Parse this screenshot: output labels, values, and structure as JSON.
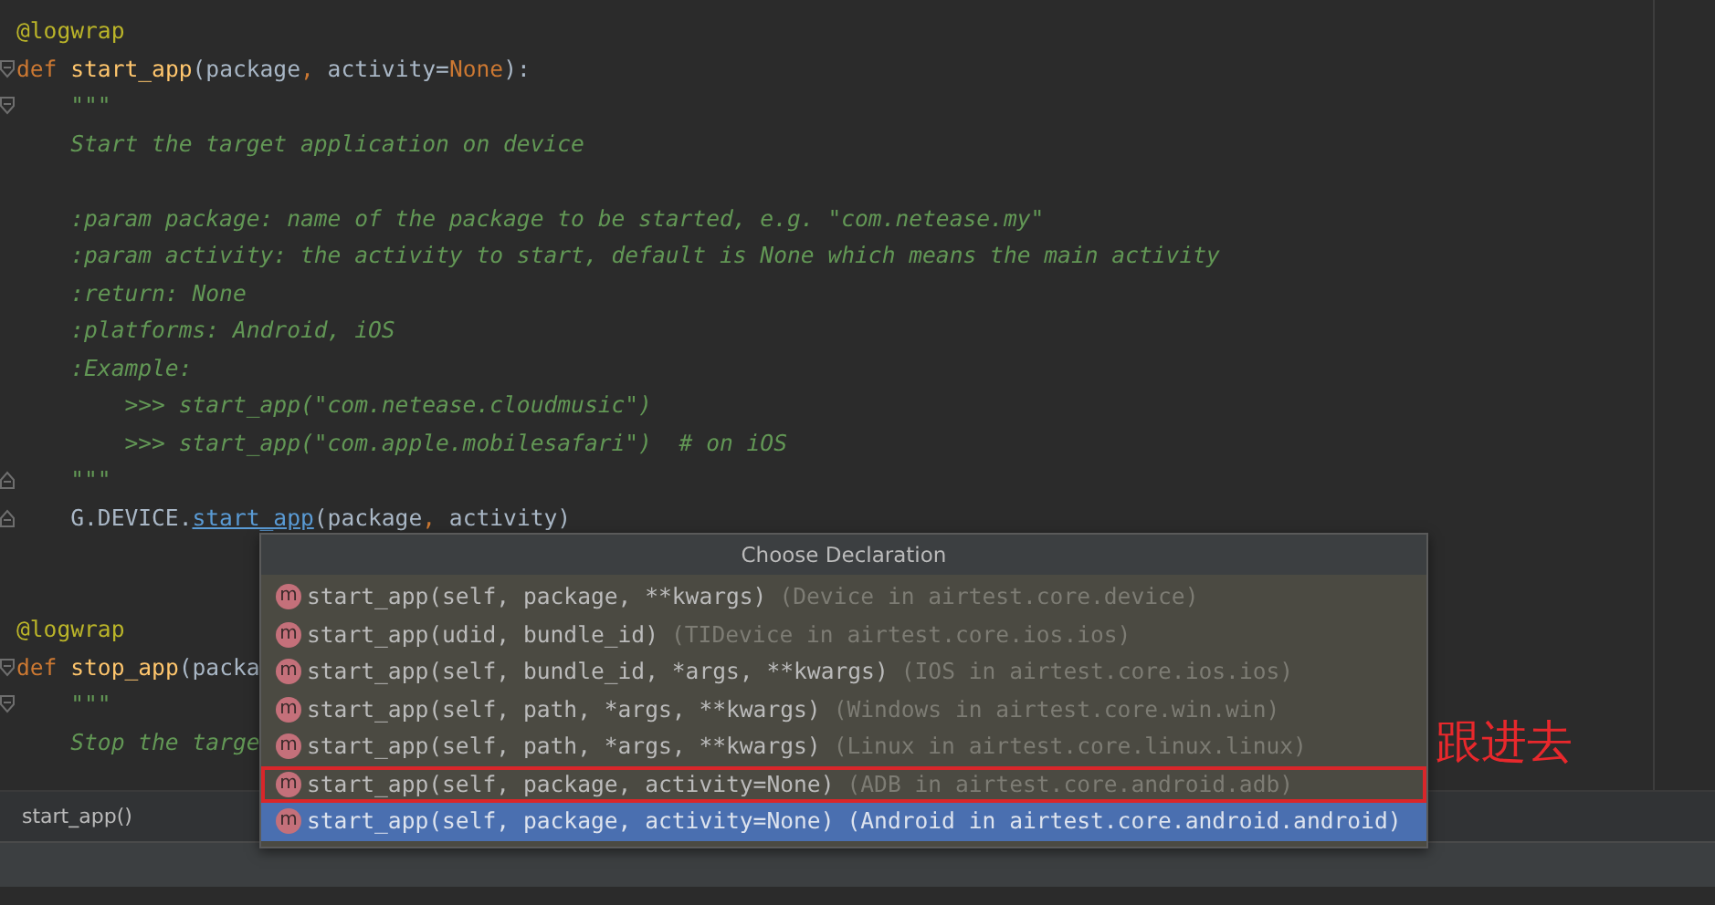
{
  "editor": {
    "lines": [
      {
        "kind": "code",
        "tokens": [
          {
            "kind": "decorator",
            "text": "@logwrap"
          }
        ]
      },
      {
        "kind": "code",
        "fold_start": true,
        "tokens": [
          {
            "kind": "keyword",
            "text": "def "
          },
          {
            "kind": "function",
            "text": "start_app"
          },
          {
            "kind": "plain",
            "text": "(package"
          },
          {
            "kind": "keyword",
            "text": ","
          },
          {
            "kind": "plain",
            "text": " activity="
          },
          {
            "kind": "keyword",
            "text": "None"
          },
          {
            "kind": "plain",
            "text": "):"
          }
        ]
      },
      {
        "kind": "code",
        "fold_start": true,
        "tokens": [
          {
            "kind": "doc",
            "text": "    \"\"\""
          }
        ]
      },
      {
        "kind": "code",
        "tokens": [
          {
            "kind": "doc",
            "text": "    Start the target application on device"
          }
        ]
      },
      {
        "kind": "blank"
      },
      {
        "kind": "code",
        "tokens": [
          {
            "kind": "doc",
            "text": "    :param package: name of the package to be started, e.g. \"com.netease.my\""
          }
        ]
      },
      {
        "kind": "code",
        "tokens": [
          {
            "kind": "doc",
            "text": "    :param activity: the activity to start, default is None which means the main activity"
          }
        ]
      },
      {
        "kind": "code",
        "tokens": [
          {
            "kind": "doc",
            "text": "    :return: None"
          }
        ]
      },
      {
        "kind": "code",
        "tokens": [
          {
            "kind": "doc",
            "text": "    :platforms: Android, iOS"
          }
        ]
      },
      {
        "kind": "code",
        "tokens": [
          {
            "kind": "doc",
            "text": "    :Example:"
          }
        ]
      },
      {
        "kind": "code",
        "tokens": [
          {
            "kind": "doc",
            "text": "        >>> start_app(\"com.netease.cloudmusic\")"
          }
        ]
      },
      {
        "kind": "code",
        "tokens": [
          {
            "kind": "doc",
            "text": "        >>> start_app(\"com.apple.mobilesafari\")  # on iOS"
          }
        ]
      },
      {
        "kind": "code",
        "fold_end": true,
        "tokens": [
          {
            "kind": "doc",
            "text": "    \"\"\""
          }
        ]
      },
      {
        "kind": "code",
        "fold_end": true,
        "tokens": [
          {
            "kind": "plain",
            "text": "    G.DEVICE."
          },
          {
            "kind": "link",
            "text": "start_app"
          },
          {
            "kind": "plain",
            "text": "(package"
          },
          {
            "kind": "keyword",
            "text": ","
          },
          {
            "kind": "plain",
            "text": " activity)"
          }
        ]
      },
      {
        "kind": "blank"
      },
      {
        "kind": "blank"
      },
      {
        "kind": "code",
        "tokens": [
          {
            "kind": "decorator",
            "text": "@logwrap"
          }
        ]
      },
      {
        "kind": "code",
        "fold_start": true,
        "tokens": [
          {
            "kind": "keyword",
            "text": "def "
          },
          {
            "kind": "function",
            "text": "stop_app"
          },
          {
            "kind": "plain",
            "text": "(packa"
          }
        ]
      },
      {
        "kind": "code",
        "fold_start": true,
        "tokens": [
          {
            "kind": "doc",
            "text": "    \"\"\""
          }
        ]
      },
      {
        "kind": "code",
        "tokens": [
          {
            "kind": "doc",
            "text": "    Stop the targe"
          }
        ]
      },
      {
        "kind": "blank"
      }
    ]
  },
  "breadcrumb": "start_app()",
  "popup": {
    "title": "Choose Declaration",
    "items": [
      {
        "icon": "m",
        "signature": "start_app(self, package, **kwargs)",
        "location": "(Device in airtest.core.device)",
        "selected": false,
        "annotated": false
      },
      {
        "icon": "m",
        "signature": "start_app(udid, bundle_id)",
        "location": "(TIDevice in airtest.core.ios.ios)",
        "selected": false,
        "annotated": false
      },
      {
        "icon": "m",
        "signature": "start_app(self, bundle_id, *args, **kwargs)",
        "location": "(IOS in airtest.core.ios.ios)",
        "selected": false,
        "annotated": false
      },
      {
        "icon": "m",
        "signature": "start_app(self, path, *args, **kwargs)",
        "location": "(Windows in airtest.core.win.win)",
        "selected": false,
        "annotated": false
      },
      {
        "icon": "m",
        "signature": "start_app(self, path, *args, **kwargs)",
        "location": "(Linux in airtest.core.linux.linux)",
        "selected": false,
        "annotated": false
      },
      {
        "icon": "m",
        "signature": "start_app(self, package, activity=None)",
        "location": "(ADB in airtest.core.android.adb)",
        "selected": false,
        "annotated": true
      },
      {
        "icon": "m",
        "signature": "start_app(self, package, activity=None)",
        "location": "(Android in airtest.core.android.android)",
        "selected": true,
        "annotated": false
      }
    ]
  },
  "annotation": {
    "text": "跟进去"
  }
}
